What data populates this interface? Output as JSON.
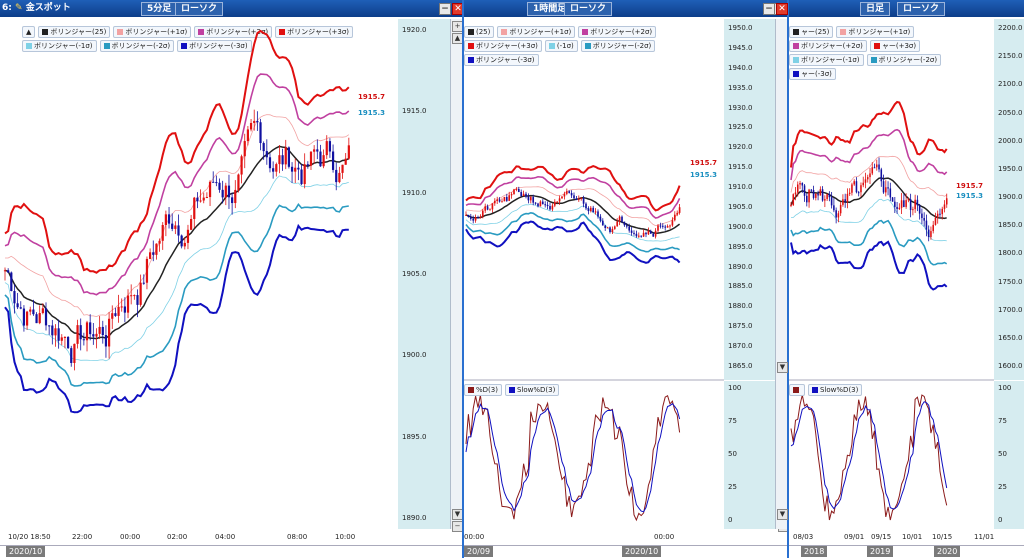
{
  "windows": [
    {
      "id": "5min",
      "symbol": "金スポット",
      "timeframe": "5分足",
      "chart_type": "ローソク",
      "legend": [
        {
          "label": "ボリンジャー(25)",
          "color": "#222222"
        },
        {
          "label": "ボリンジャー(+1σ)",
          "color": "#f2a2a2"
        },
        {
          "label": "ボリンジャー(+2σ)",
          "color": "#c040a0"
        },
        {
          "label": "ボリンジャー(+3σ)",
          "color": "#e01010"
        },
        {
          "label": "ボリンジャー(-1σ)",
          "color": "#7fd1e6"
        },
        {
          "label": "ボリンジャー(-2σ)",
          "color": "#2a9bc1"
        },
        {
          "label": "ボリンジャー(-3σ)",
          "color": "#1010c0"
        }
      ],
      "price_ticks": [
        "1920.0",
        "1915.0",
        "1910.0",
        "1905.0",
        "1900.0",
        "1895.0",
        "1890.0"
      ],
      "last_high": "1915.7",
      "last_low": "1915.3",
      "time_labels": [
        "10/20 18:50",
        "22:00",
        "00:00",
        "02:00",
        "04:00",
        "08:00",
        "10:00"
      ],
      "nav_label": "2020/10"
    },
    {
      "id": "1hour",
      "timeframe": "1時間足",
      "chart_type": "ローソク",
      "legend": [
        {
          "label": "(25)",
          "color": "#222222"
        },
        {
          "label": "ボリンジャー(+1σ)",
          "color": "#f2a2a2"
        },
        {
          "label": "ボリンジャー(+2σ)",
          "color": "#c040a0"
        },
        {
          "label": "ボリンジャー(+3σ)",
          "color": "#e01010"
        },
        {
          "label": "(-1σ)",
          "color": "#7fd1e6"
        },
        {
          "label": "ボリンジャー(-2σ)",
          "color": "#2a9bc1"
        },
        {
          "label": "ボリンジャー(-3σ)",
          "color": "#1010c0"
        }
      ],
      "price_ticks": [
        "1950.0",
        "1945.0",
        "1940.0",
        "1935.0",
        "1930.0",
        "1925.0",
        "1920.0",
        "1915.0",
        "1910.0",
        "1905.0",
        "1900.0",
        "1895.0",
        "1890.0",
        "1885.0",
        "1880.0",
        "1875.0",
        "1870.0",
        "1865.0"
      ],
      "last_high": "1915.7",
      "last_low": "1915.3",
      "stoch_legend": [
        {
          "label": "%D(3)",
          "color": "#8b1a1a"
        },
        {
          "label": "Slow%D(3)",
          "color": "#1010c0"
        }
      ],
      "stoch_ticks": [
        "100",
        "75",
        "50",
        "25",
        "0"
      ],
      "time_labels": [
        "00:00",
        "00:00"
      ],
      "nav_labels": [
        "20/09",
        "2020/10"
      ]
    },
    {
      "id": "daily",
      "timeframe": "日足",
      "chart_type": "ローソク",
      "legend": [
        {
          "label": "ャー(25)",
          "color": "#222222"
        },
        {
          "label": "ボリンジャー(+1σ)",
          "color": "#f2a2a2"
        },
        {
          "label": "ボリンジャー(+2σ)",
          "color": "#c040a0"
        },
        {
          "label": "ャー(+3σ)",
          "color": "#e01010"
        },
        {
          "label": "ボリンジャー(-1σ)",
          "color": "#7fd1e6"
        },
        {
          "label": "ボリンジャー(-2σ)",
          "color": "#2a9bc1"
        },
        {
          "label": "ャー(-3σ)",
          "color": "#1010c0"
        }
      ],
      "price_ticks": [
        "2200.0",
        "2150.0",
        "2100.0",
        "2050.0",
        "2000.0",
        "1950.0",
        "1900.0",
        "1850.0",
        "1800.0",
        "1750.0",
        "1700.0",
        "1650.0",
        "1600.0"
      ],
      "last_high": "1915.7",
      "last_low": "1915.3",
      "stoch_legend": [
        {
          "label": "",
          "color": "#8b1a1a"
        },
        {
          "label": "Slow%D(3)",
          "color": "#1010c0"
        }
      ],
      "stoch_ticks": [
        "100",
        "75",
        "50",
        "25",
        "0"
      ],
      "time_labels": [
        "08/03",
        "09/01",
        "09/15",
        "10/01",
        "10/15",
        "11/01"
      ],
      "nav_labels": [
        "2018",
        "2019",
        "2020"
      ]
    }
  ],
  "panel_number": "6"
}
